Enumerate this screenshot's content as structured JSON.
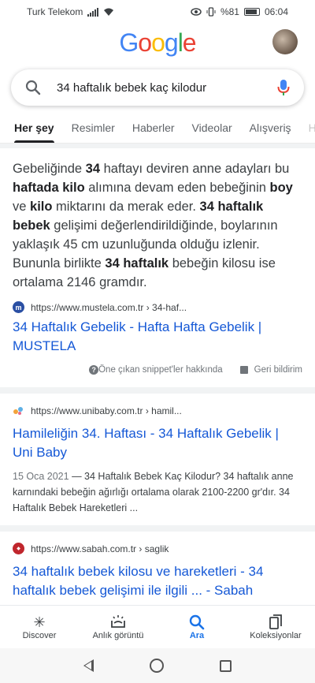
{
  "status": {
    "carrier": "Turk Telekom",
    "battery": "%81",
    "time": "06:04"
  },
  "header": {
    "logo_letters": [
      "G",
      "o",
      "o",
      "g",
      "l",
      "e"
    ],
    "logo_colors": [
      "#4285F4",
      "#EA4335",
      "#FBBC05",
      "#4285F4",
      "#34A853",
      "#EA4335"
    ]
  },
  "search": {
    "query": "34 haftalık bebek kaç kilodur"
  },
  "tabs": [
    "Her şey",
    "Resimler",
    "Haberler",
    "Videolar",
    "Alışveriş",
    "H"
  ],
  "snippet": {
    "segments": [
      {
        "t": "Gebeliğinde ",
        "b": false
      },
      {
        "t": "34",
        "b": true
      },
      {
        "t": " haftayı deviren anne adayları bu ",
        "b": false
      },
      {
        "t": "haftada kilo",
        "b": true
      },
      {
        "t": " alımına devam eden bebeğinin ",
        "b": false
      },
      {
        "t": "boy",
        "b": true
      },
      {
        "t": " ve ",
        "b": false
      },
      {
        "t": "kilo",
        "b": true
      },
      {
        "t": " miktarını da merak eder. ",
        "b": false
      },
      {
        "t": "34 haftalık bebek",
        "b": true
      },
      {
        "t": " gelişimi değerlendirildiğinde, boylarının yaklaşık 45 cm uzunluğunda olduğu izlenir. Bununla birlikte ",
        "b": false
      },
      {
        "t": "34 haftalık",
        "b": true
      },
      {
        "t": " bebeğin kilosu ise ortalama 2146 gramdır.",
        "b": false
      }
    ],
    "source_url": "https://www.mustela.com.tr › 34-haf...",
    "favicon_letter": "m",
    "title": "34 Haftalık Gebelik - Hafta Hafta Gebelik | MUSTELA",
    "about": "Öne çıkan snippet'ler hakkında",
    "feedback": "Geri bildirim"
  },
  "results": [
    {
      "url": "https://www.unibaby.com.tr › hamil...",
      "title": "Hamileliğin 34. Haftası - 34 Haftalık Gebelik | Uni Baby",
      "date": "15 Oca 2021",
      "desc": " — 34 Haftalık Bebek Kaç Kilodur? 34 haftalık anne karnındaki bebeğin ağırlığı ortalama olarak 2100-2200 gr'dır. 34 Haftalık Bebek Hareketleri ..."
    },
    {
      "url": "https://www.sabah.com.tr › saglik",
      "title": "34 haftalık bebek kilosu ve hareketleri - 34 haftalık bebek gelişimi ile ilgili ... - Sabah",
      "date": "",
      "desc": ""
    }
  ],
  "bottomnav": [
    {
      "label": "Discover",
      "icon": "asterisk-icon"
    },
    {
      "label": "Anlık görüntü",
      "icon": "snapshot-icon"
    },
    {
      "label": "Ara",
      "icon": "search-icon"
    },
    {
      "label": "Koleksiyonlar",
      "icon": "collections-icon"
    }
  ],
  "colors": {
    "link": "#1558d6",
    "active": "#1a73e8"
  }
}
